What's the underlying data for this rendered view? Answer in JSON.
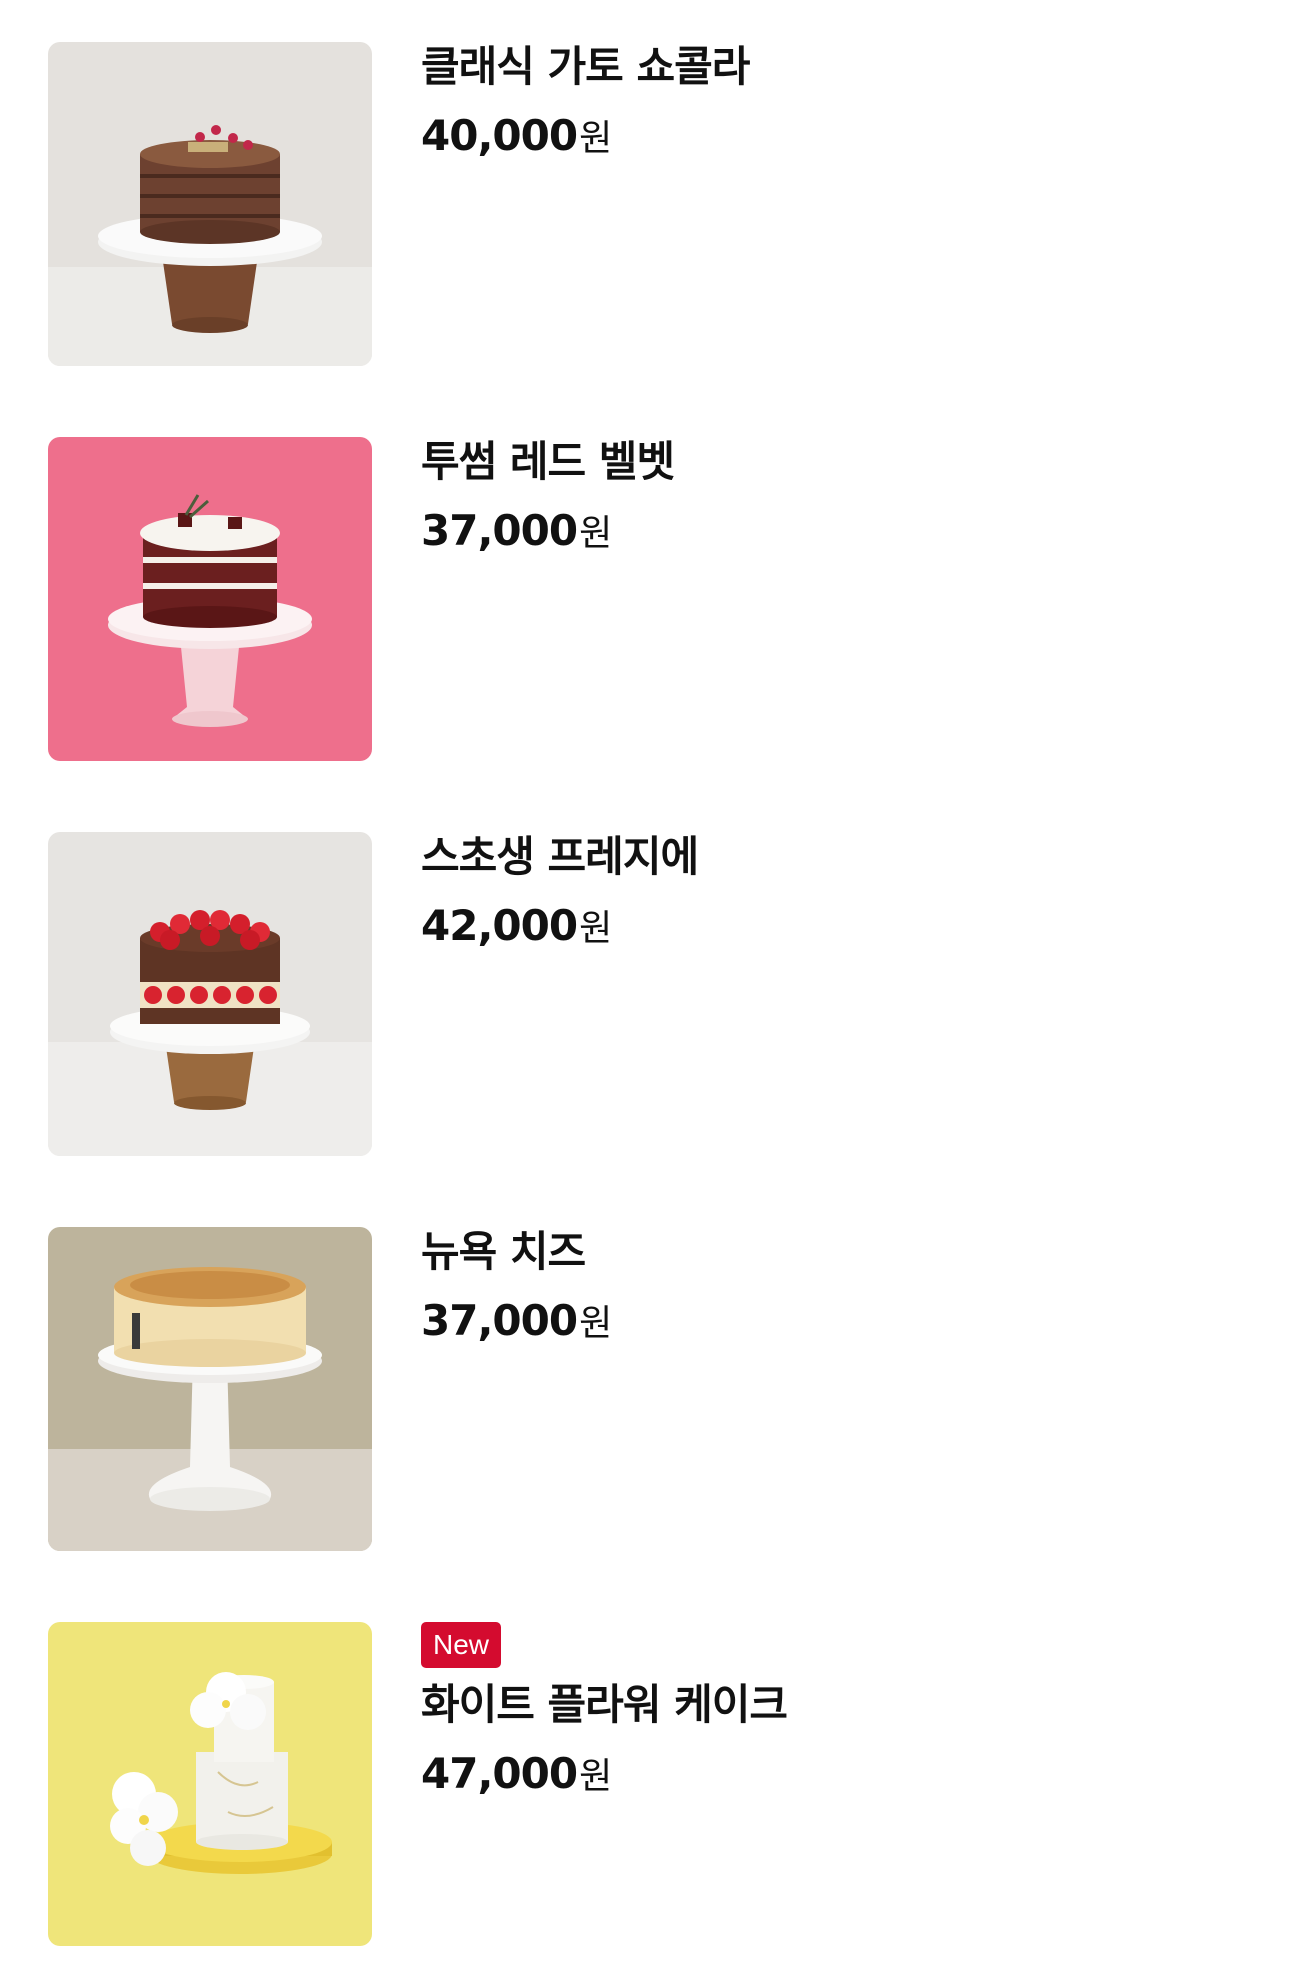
{
  "currency": "원",
  "products": [
    {
      "name": "클래식 가토 쇼콜라",
      "price": "40,000",
      "badge": null,
      "image": "chocolate-cake-image"
    },
    {
      "name": "투썸 레드 벨벳",
      "price": "37,000",
      "badge": null,
      "image": "red-velvet-cake-image"
    },
    {
      "name": "스초생 프레지에",
      "price": "42,000",
      "badge": null,
      "image": "strawberry-cake-image"
    },
    {
      "name": "뉴욕 치즈",
      "price": "37,000",
      "badge": null,
      "image": "cheesecake-image"
    },
    {
      "name": "화이트 플라워 케이크",
      "price": "47,000",
      "badge": "New",
      "image": "white-flower-cake-image"
    }
  ]
}
